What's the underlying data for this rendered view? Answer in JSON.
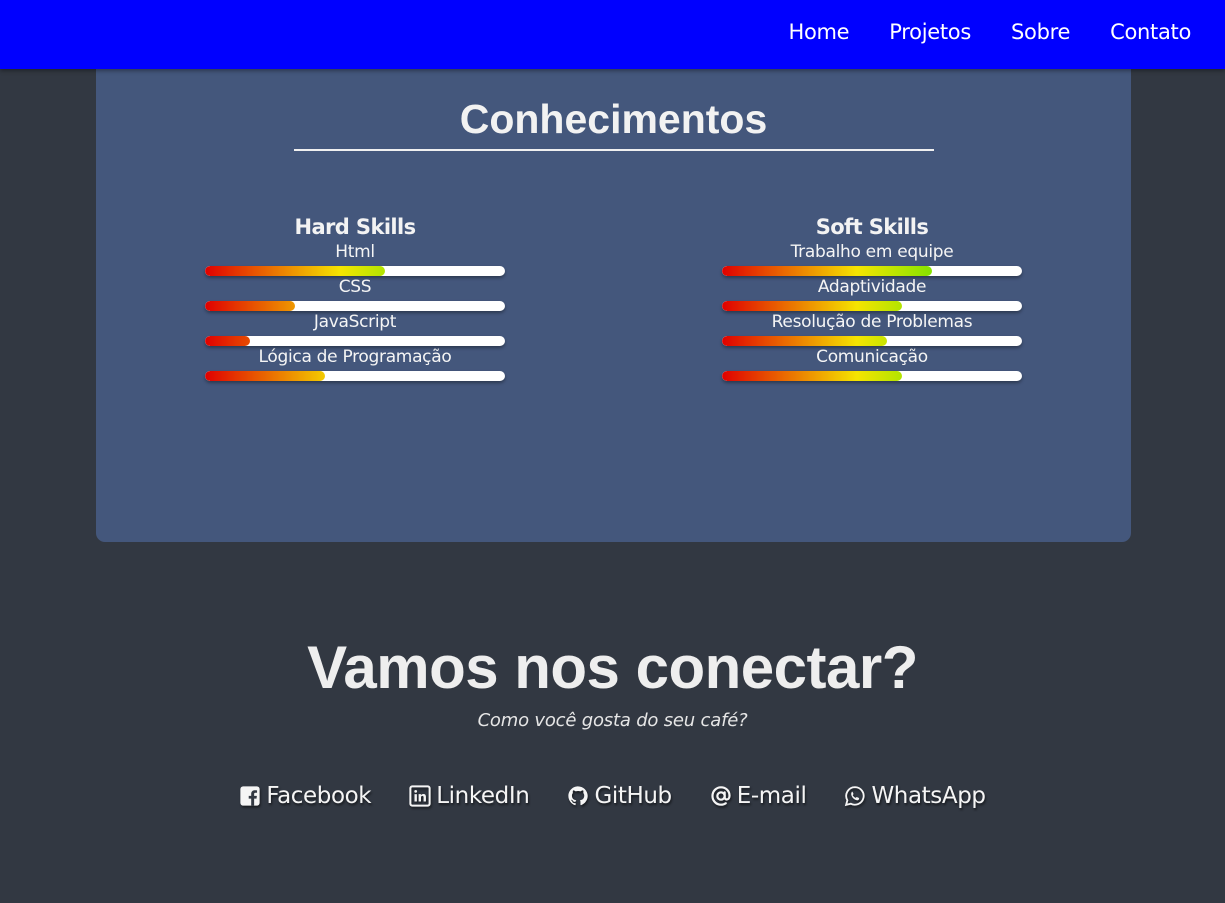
{
  "nav": {
    "items": [
      "Home",
      "Projetos",
      "Sobre",
      "Contato"
    ],
    "background": "#0000ff"
  },
  "knowledge": {
    "title": "Conhecimentos",
    "background": "#44577c",
    "hard": {
      "title": "Hard Skills",
      "skills": [
        {
          "label": "Html",
          "level": 0.6
        },
        {
          "label": "CSS",
          "level": 0.3
        },
        {
          "label": "JavaScript",
          "level": 0.15
        },
        {
          "label": "Lógica de Programação",
          "level": 0.4
        }
      ]
    },
    "soft": {
      "title": "Soft Skills",
      "skills": [
        {
          "label": "Trabalho em equipe",
          "level": 0.7
        },
        {
          "label": "Adaptividade",
          "level": 0.6
        },
        {
          "label": "Resolução de Problemas",
          "level": 0.55
        },
        {
          "label": "Comunicação",
          "level": 0.6
        }
      ]
    }
  },
  "connect": {
    "title": "Vamos nos conectar?",
    "subtitle": "Como você gosta do seu café?"
  },
  "social": [
    {
      "label": "Facebook",
      "icon": "facebook-icon"
    },
    {
      "label": "LinkedIn",
      "icon": "linkedin-icon"
    },
    {
      "label": "GitHub",
      "icon": "github-icon"
    },
    {
      "label": "E-mail",
      "icon": "at-sign-icon"
    },
    {
      "label": "WhatsApp",
      "icon": "whatsapp-icon"
    }
  ],
  "colors": {
    "page_background": "#323842",
    "skill_gradient": [
      "#e00000",
      "#f5e400",
      "#00e400"
    ],
    "track": "#ffffff"
  }
}
